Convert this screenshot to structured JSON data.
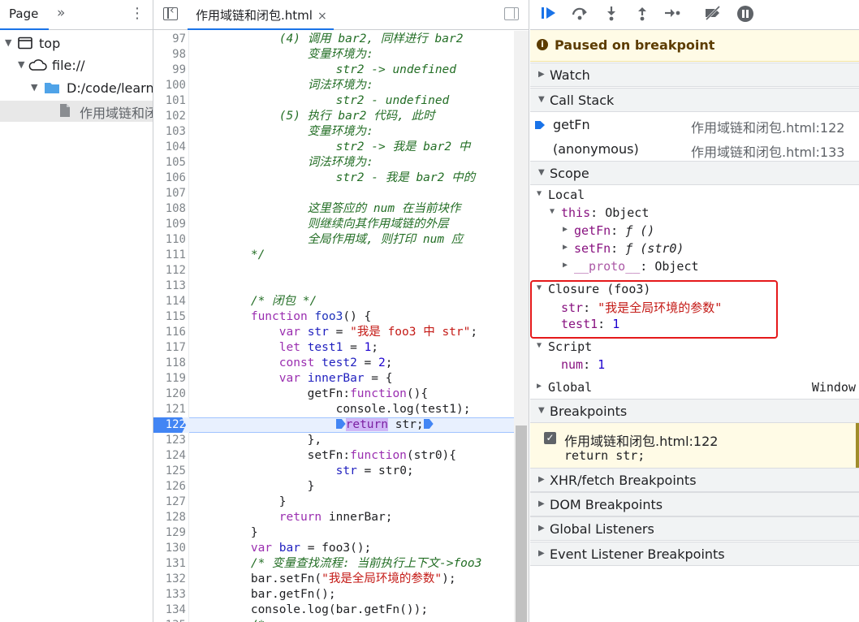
{
  "navigator": {
    "tab_label": "Page",
    "more_glyph": "»",
    "menu_glyph": "⋮",
    "tree": [
      {
        "label": "top",
        "depth": 0,
        "icon": "frame-icon",
        "arrow": "▼"
      },
      {
        "label": "file://",
        "depth": 1,
        "icon": "cloud-icon",
        "arrow": "▼"
      },
      {
        "label": "D:/code/learning",
        "depth": 2,
        "icon": "folder-icon",
        "arrow": "▼"
      },
      {
        "label": "作用域链和闭包.html",
        "depth": 3,
        "icon": "file-icon",
        "arrow": ""
      }
    ]
  },
  "editor": {
    "file_tab": "作用域链和闭包.html",
    "close_glyph": "×",
    "current_line": 122,
    "lines": [
      {
        "n": 97,
        "html": "            <span class=\"c\">(4) 调用 bar2, 同样进行 bar2 </span>"
      },
      {
        "n": 98,
        "html": "                <span class=\"c\">变量环境为:</span>"
      },
      {
        "n": 99,
        "html": "                    <span class=\"c\">str2 -> undefined</span>"
      },
      {
        "n": 100,
        "html": "                <span class=\"c\">词法环境为:</span>"
      },
      {
        "n": 101,
        "html": "                    <span class=\"c\">str2 - undefined</span>"
      },
      {
        "n": 102,
        "html": "            <span class=\"c\">(5) 执行 bar2 代码, 此时</span>"
      },
      {
        "n": 103,
        "html": "                <span class=\"c\">变量环境为:</span>"
      },
      {
        "n": 104,
        "html": "                    <span class=\"c\">str2 -> 我是 bar2 中</span>"
      },
      {
        "n": 105,
        "html": "                <span class=\"c\">词法环境为:</span>"
      },
      {
        "n": 106,
        "html": "                    <span class=\"c\">str2 - 我是 bar2 中的</span>"
      },
      {
        "n": 107,
        "html": ""
      },
      {
        "n": 108,
        "html": "                <span class=\"c\">这里答应的 num 在当前块作</span>"
      },
      {
        "n": 109,
        "html": "                <span class=\"c\">则继续向其作用域链的外层</span>"
      },
      {
        "n": 110,
        "html": "                <span class=\"c\">全局作用域, 则打印 num 应</span>"
      },
      {
        "n": 111,
        "html": "        <span class=\"c\">*/</span>"
      },
      {
        "n": 112,
        "html": ""
      },
      {
        "n": 113,
        "html": ""
      },
      {
        "n": 114,
        "html": "        <span class=\"c\">/* 闭包 */</span>"
      },
      {
        "n": 115,
        "html": "        <span class=\"k\">function</span> <span class=\"f\">foo3</span>() {"
      },
      {
        "n": 116,
        "html": "            <span class=\"k\">var</span> <span class=\"v\">str</span> = <span class=\"s\">\"我是 foo3 中 str\"</span>;"
      },
      {
        "n": 117,
        "html": "            <span class=\"k\">let</span> <span class=\"v\">test1</span> = <span class=\"n\">1</span>;"
      },
      {
        "n": 118,
        "html": "            <span class=\"k\">const</span> <span class=\"v\">test2</span> = <span class=\"n\">2</span>;"
      },
      {
        "n": 119,
        "html": "            <span class=\"k\">var</span> <span class=\"v\">innerBar</span> = {"
      },
      {
        "n": 120,
        "html": "                getFn:<span class=\"k\">function</span>(){"
      },
      {
        "n": 121,
        "html": "                    console.log(test1);"
      },
      {
        "n": 122,
        "html": "                    <span class=\"pm\"></span><span class=\"ret\">return</span> str;<span class=\"pm\"></span>"
      },
      {
        "n": 123,
        "html": "                },"
      },
      {
        "n": 124,
        "html": "                setFn:<span class=\"k\">function</span>(str0){"
      },
      {
        "n": 125,
        "html": "                    <span class=\"v\">str</span> = str0;"
      },
      {
        "n": 126,
        "html": "                }"
      },
      {
        "n": 127,
        "html": "            }"
      },
      {
        "n": 128,
        "html": "            <span class=\"k\">return</span> innerBar;"
      },
      {
        "n": 129,
        "html": "        }"
      },
      {
        "n": 130,
        "html": "        <span class=\"k\">var</span> <span class=\"v\">bar</span> = foo3();"
      },
      {
        "n": 131,
        "html": "        <span class=\"c\">/* 变量查找流程: 当前执行上下文->foo3</span>"
      },
      {
        "n": 132,
        "html": "        bar.setFn(<span class=\"s\">\"我是全局环境的参数\"</span>);"
      },
      {
        "n": 133,
        "html": "        bar.getFn();"
      },
      {
        "n": 134,
        "html": "        console.log(bar.getFn());"
      },
      {
        "n": 135,
        "html": "        <span class=\"c\">/*</span>"
      }
    ]
  },
  "debugger": {
    "paused_icon": "i",
    "paused_text": "Paused on breakpoint",
    "sections": {
      "watch": "Watch",
      "call_stack": "Call Stack",
      "scope": "Scope",
      "breakpoints": "Breakpoints",
      "xhr": "XHR/fetch Breakpoints",
      "dom": "DOM Breakpoints",
      "global_listeners": "Global Listeners",
      "event_listeners": "Event Listener Breakpoints"
    },
    "call_stack": [
      {
        "fn": "getFn",
        "loc": "作用域链和闭包.html:122"
      },
      {
        "fn": "(anonymous)",
        "loc": "作用域链和闭包.html:133"
      }
    ],
    "scope": {
      "local": "Local",
      "this_key": "this",
      "this_val": "Object",
      "getFn_key": "getFn",
      "getFn_val": "ƒ ()",
      "setFn_key": "setFn",
      "setFn_val": "ƒ (str0)",
      "proto_key": "__proto__",
      "proto_val": "Object",
      "closure": "Closure (foo3)",
      "str_key": "str",
      "str_val": "\"我是全局环境的参数\"",
      "test1_key": "test1",
      "test1_val": "1",
      "script": "Script",
      "num_key": "num",
      "num_val": "1",
      "global": "Global",
      "global_val": "Window"
    },
    "breakpoint": {
      "file": "作用域链和闭包.html:122",
      "code": "return str;"
    }
  }
}
